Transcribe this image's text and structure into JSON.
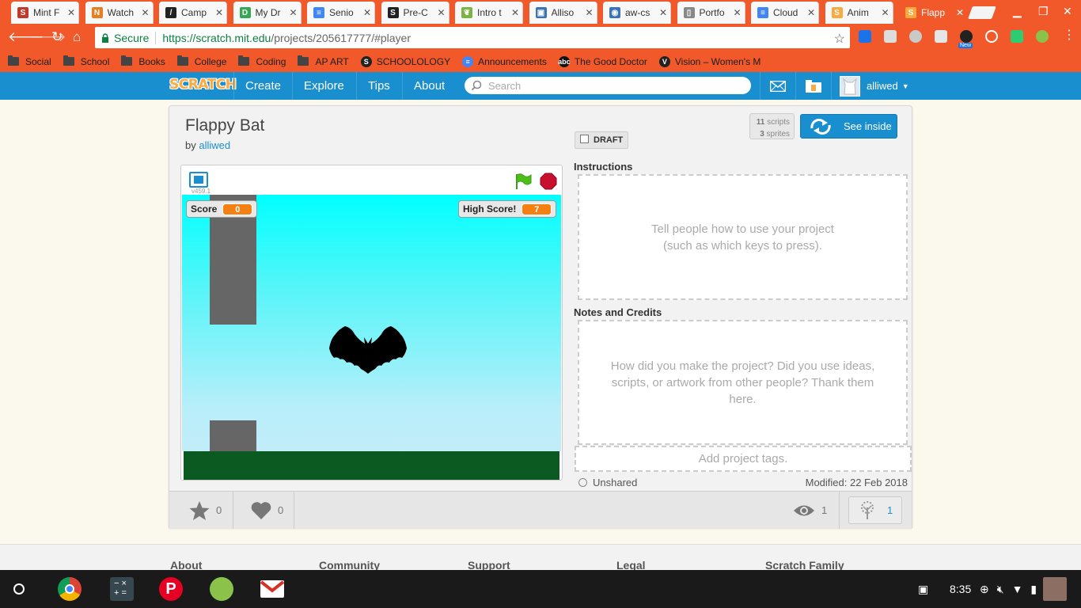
{
  "browser": {
    "tabs": [
      {
        "label": "Mint F",
        "favicon": "S",
        "color": "#c0392b"
      },
      {
        "label": "Watch",
        "favicon": "N",
        "color": "#e67e22"
      },
      {
        "label": "Camp",
        "favicon": "/",
        "color": "#222222"
      },
      {
        "label": "My Dr",
        "favicon": "D",
        "color": "#34a853"
      },
      {
        "label": "Senio",
        "favicon": "≡",
        "color": "#4285f4"
      },
      {
        "label": "Pre-C",
        "favicon": "S",
        "color": "#222222"
      },
      {
        "label": "Intro t",
        "favicon": "❦",
        "color": "#7cb342"
      },
      {
        "label": "Alliso",
        "favicon": "▣",
        "color": "#3b73b9"
      },
      {
        "label": "aw-cs",
        "favicon": "◉",
        "color": "#3b73b9"
      },
      {
        "label": "Portfo",
        "favicon": "▯",
        "color": "#888888"
      },
      {
        "label": "Cloud",
        "favicon": "≡",
        "color": "#4285f4"
      },
      {
        "label": "Anim",
        "favicon": "S",
        "color": "#f9a93d"
      },
      {
        "label": "Flapp",
        "favicon": "S",
        "color": "#f9a93d"
      }
    ],
    "active_tab": 12,
    "close_glyph": "✕",
    "secure_label": "Secure",
    "url_scheme_host": "https://scratch.mit.edu",
    "url_path": "/projects/205617777/#player",
    "extension_new_badge": "New",
    "bookmarks": [
      {
        "label": "Social",
        "kind": "folder"
      },
      {
        "label": "School",
        "kind": "folder"
      },
      {
        "label": "Books",
        "kind": "folder"
      },
      {
        "label": "College",
        "kind": "folder"
      },
      {
        "label": "Coding",
        "kind": "folder"
      },
      {
        "label": "AP ART",
        "kind": "folder"
      },
      {
        "label": "SCHOOLOLOGY",
        "kind": "site",
        "icon": "S",
        "color": "#222222"
      },
      {
        "label": "Announcements",
        "kind": "site",
        "icon": "≡",
        "color": "#4285f4"
      },
      {
        "label": "The Good Doctor",
        "kind": "site",
        "icon": "abc",
        "color": "#111111"
      },
      {
        "label": "Vision – Women's M",
        "kind": "site",
        "icon": "V",
        "color": "#222222"
      }
    ]
  },
  "scratch_nav": {
    "logo": "SCRATCH",
    "links": [
      "Create",
      "Explore",
      "Tips",
      "About"
    ],
    "search_placeholder": "Search",
    "username": "alliwed"
  },
  "project": {
    "title": "Flappy Bat",
    "by_prefix": "by",
    "author": "alliwed",
    "draft_label": "DRAFT",
    "scripts_count": "11",
    "scripts_label": "scripts",
    "sprites_count": "3",
    "sprites_label": "sprites",
    "see_inside_label": "See inside",
    "version": "v459.1",
    "score_label": "Score",
    "score_value": "0",
    "high_score_label": "High Score!",
    "high_score_value": "7",
    "instructions_heading": "Instructions",
    "instructions_placeholder": "Tell people how to use your project (such as which keys to press).",
    "notes_heading": "Notes and Credits",
    "notes_placeholder": "How did you make the project? Did you use ideas, scripts, or artwork from other people? Thank them here.",
    "tags_placeholder": "Add project tags.",
    "share_status": "Unshared",
    "modified_label": "Modified: 22 Feb 2018",
    "favorites": "0",
    "loves": "0",
    "views": "1",
    "remixes": "1"
  },
  "footer": {
    "columns": [
      "About",
      "Community",
      "Support",
      "Legal",
      "Scratch Family"
    ]
  },
  "shelf": {
    "time": "8:35"
  },
  "colors": {
    "chrome_accent": "#f1592a",
    "scratch_blue": "#1a8fd0",
    "scratch_orange": "#f9a93d",
    "monitor_orange": "#f47f12",
    "ground_green": "#0a5a21"
  }
}
